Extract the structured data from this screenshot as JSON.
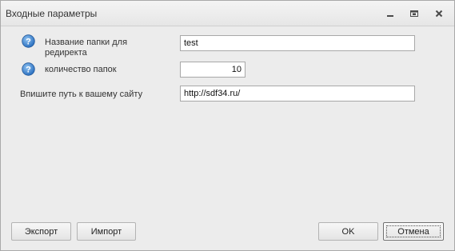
{
  "window": {
    "title": "Входные параметры",
    "controls": {
      "minimize_icon": "minimize-icon",
      "maximize_icon": "maximize-icon",
      "close_icon": "close-icon"
    }
  },
  "fields": [
    {
      "label_line1": "Название папки для",
      "label_line2": "редиректа",
      "value": "test",
      "has_help": true
    },
    {
      "label_line1": "количество папок",
      "value": "10",
      "has_help": true
    },
    {
      "label_line1": "Впишите путь к вашему сайту",
      "value": "http://sdf34.ru/",
      "has_help": false
    }
  ],
  "buttons": {
    "export": "Экспорт",
    "import": "Импорт",
    "ok": "OK",
    "cancel": "Отмена"
  },
  "colors": {
    "help_icon_fill": "#3b7fc8",
    "window_bg": "#ececec"
  }
}
